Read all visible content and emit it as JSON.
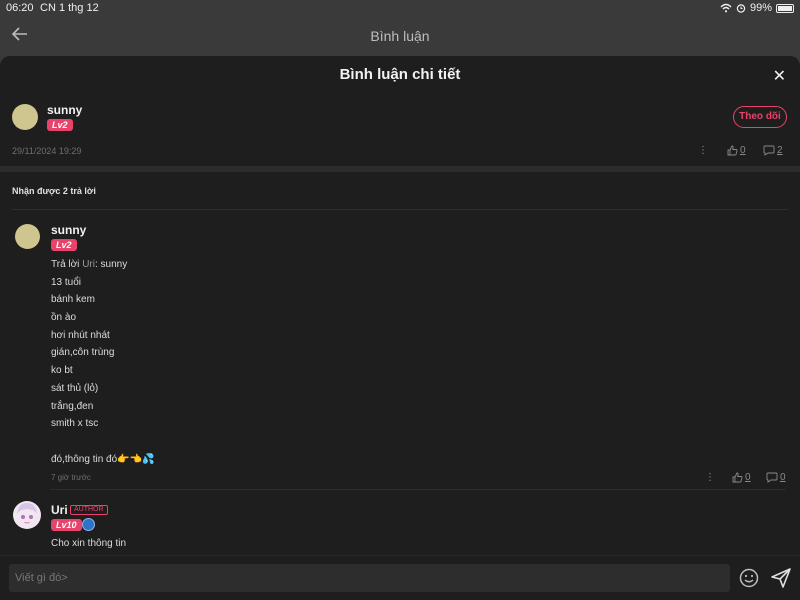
{
  "status": {
    "time": "06:20",
    "date": "CN 1 thg 12",
    "battery": "99%"
  },
  "topbar": {
    "title": "Bình luận"
  },
  "panel": {
    "title": "Bình luận chi tiết"
  },
  "main_comment": {
    "username": "sunny",
    "level": "Lv2",
    "follow_label": "Theo dõi",
    "timestamp": "29/11/2024 19:29",
    "likes": "0",
    "replies": "2"
  },
  "replies_header": "Nhận được 2 trả lời",
  "reply1": {
    "username": "sunny",
    "level": "Lv2",
    "reply_prefix": "Trả lời ",
    "reply_to": "Uri",
    "lines": [
      "sunny",
      "13 tuổi",
      "bánh kem",
      "ồn ào",
      "hơi nhút nhát",
      "gián,côn trùng",
      "ko bt",
      "sát thủ (lỏ)",
      "trắng,đen",
      "smith x tsc",
      "",
      "đó,thông tin đó👉👈💦"
    ],
    "time": "7 giờ trước",
    "likes": "0",
    "replies": "0"
  },
  "reply2": {
    "username": "Uri",
    "author_tag": "AUTHOR",
    "level": "Lv10",
    "text": "Cho xin thông tin"
  },
  "input": {
    "placeholder": "Viết gì đó>"
  },
  "colors": {
    "accent": "#e8436b",
    "panel_bg": "#1e1e1e",
    "avatar_beige": "#cfc58f"
  }
}
